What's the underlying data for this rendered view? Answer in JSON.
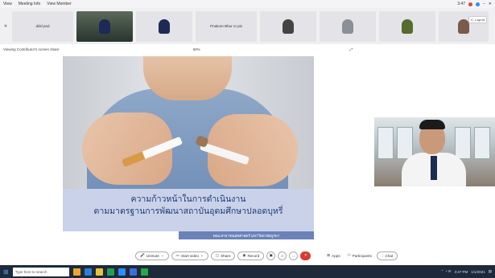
{
  "menu": {
    "items": [
      "View",
      "Meeting Info",
      "View Member"
    ]
  },
  "clock": "3:47",
  "participants": [
    {
      "name": "ddsl pnd",
      "type": "name"
    },
    {
      "name": "",
      "type": "video"
    },
    {
      "name": "",
      "type": "avatar"
    },
    {
      "name": "Pnakorn Bhur ro pis",
      "type": "name"
    },
    {
      "name": "",
      "type": "avatar"
    },
    {
      "name": "",
      "type": "avatar"
    },
    {
      "name": "",
      "type": "avatar"
    },
    {
      "name": "",
      "type": "avatar"
    }
  ],
  "speaker_tooltip": "C. Lay.nd",
  "subbar": {
    "left": "Viewing Contributor's screen share",
    "zoom": "50%"
  },
  "slide": {
    "title_line1": "ความก้าวหน้าในการดำเนินงาน",
    "title_line2": "ตามมาตรฐานการพัฒนาสถาบันอุดมศึกษาปลอดบุหรี่",
    "subtitle": "คณะสาธารณสุขศาสตร์ มหาวิทยาลัยบูรพา",
    "footer": ""
  },
  "controls": {
    "unmute": "Unmute",
    "start_video": "Start video",
    "share": "Share",
    "record": "Record",
    "apps": "Apps",
    "participants": "Participants",
    "chat": "Chat"
  },
  "taskbar": {
    "search": "Type here to search",
    "time": "3:47 PM",
    "date": "1/1/2021"
  },
  "colors": {
    "slide_title": "#1f3a78",
    "slide_band": "#c9d2e8",
    "end_button": "#d93a2f"
  }
}
